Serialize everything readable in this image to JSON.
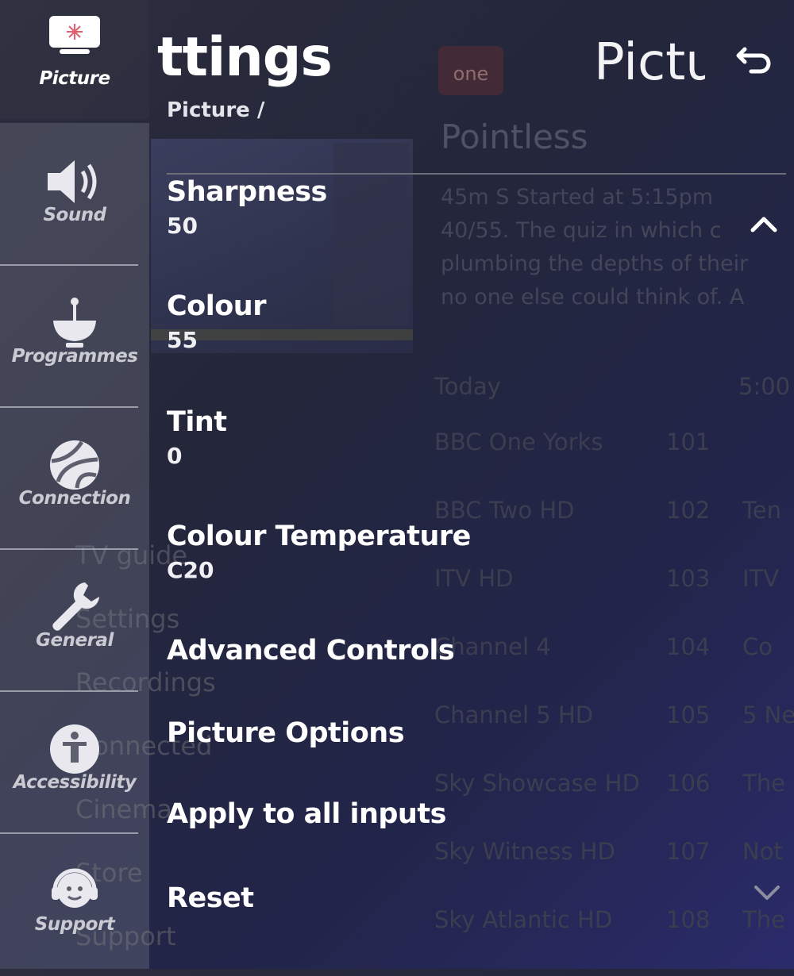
{
  "nav": {
    "items": [
      {
        "label": "Picture",
        "icon": "picture-icon"
      },
      {
        "label": "Sound",
        "icon": "speaker-icon"
      },
      {
        "label": "Programmes",
        "icon": "satellite-dish-icon"
      },
      {
        "label": "Connection",
        "icon": "globe-icon"
      },
      {
        "label": "General",
        "icon": "wrench-icon"
      },
      {
        "label": "Accessibility",
        "icon": "accessibility-icon"
      },
      {
        "label": "Support",
        "icon": "headset-icon"
      }
    ]
  },
  "header": {
    "title": "ttings",
    "breadcrumb": "Picture /",
    "right_title": "Pictu",
    "back_icon": "back-arrow-icon"
  },
  "settings": {
    "items": [
      {
        "name": "Sharpness",
        "value": "50"
      },
      {
        "name": "Colour",
        "value": "55"
      },
      {
        "name": "Tint",
        "value": "0"
      },
      {
        "name": "Colour Temperature",
        "value": "C20"
      },
      {
        "name": "Advanced Controls"
      },
      {
        "name": "Picture Options"
      },
      {
        "name": "Apply to all inputs"
      },
      {
        "name": "Reset"
      }
    ],
    "scroll_up_icon": "chevron-up-icon",
    "scroll_down_icon": "chevron-down-icon"
  },
  "background": {
    "channel_logo": "one",
    "programme_title": "Pointless",
    "programme_desc": [
      "45m  S  Started at 5:15pm",
      "40/55. The quiz in which c",
      "plumbing the depths of their",
      "no one else could think of. A"
    ],
    "today_label": "Today",
    "today_time": "5:00",
    "channels": [
      {
        "name": "BBC One Yorks",
        "number": "101",
        "extra": ""
      },
      {
        "name": "BBC Two HD",
        "number": "102",
        "extra": "Ten"
      },
      {
        "name": "ITV HD",
        "number": "103",
        "extra": "ITV"
      },
      {
        "name": "Channel 4",
        "number": "104",
        "extra": "Co"
      },
      {
        "name": "Channel 5 HD",
        "number": "105",
        "extra": "5 Ne"
      },
      {
        "name": "Sky Showcase HD",
        "number": "106",
        "extra": "The"
      },
      {
        "name": "Sky Witness HD",
        "number": "107",
        "extra": "Not"
      },
      {
        "name": "Sky Atlantic HD",
        "number": "108",
        "extra": "The"
      }
    ],
    "guide_items": [
      "TV guide",
      "Settings",
      "Recordings",
      "Connected",
      "Cinema",
      "Store",
      "Support"
    ]
  },
  "colors": {
    "background": "#24263a",
    "nav_panel": "#5e606f",
    "text": "#ffffff"
  }
}
